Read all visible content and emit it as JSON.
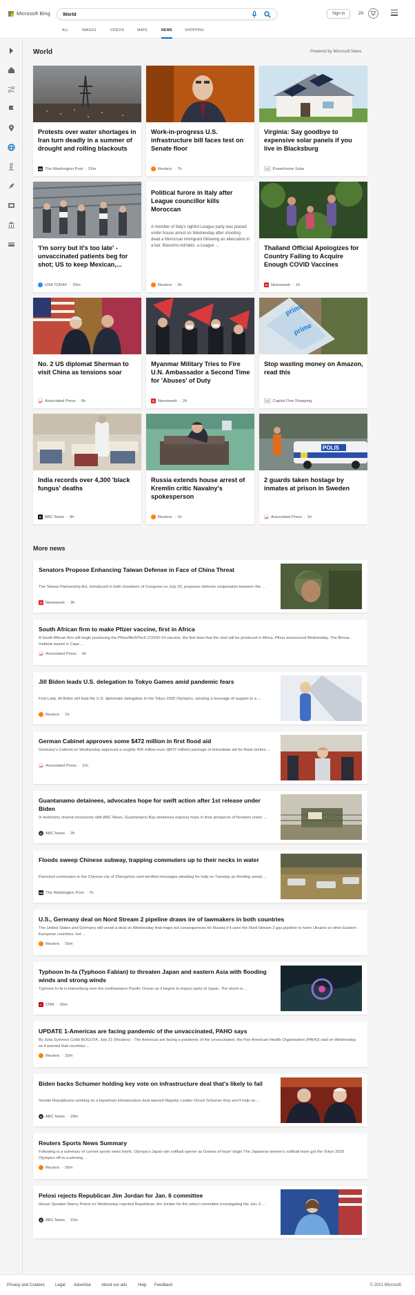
{
  "header": {
    "logo_text": "Microsoft Bing",
    "search_value": "World",
    "signin_label": "Sign in",
    "reward_points": "20"
  },
  "tabs": [
    "ALL",
    "IMAGES",
    "VIDEOS",
    "MAPS",
    "NEWS",
    "SHOPPING"
  ],
  "active_tab": "NEWS",
  "section": {
    "title": "World",
    "powered_by": "Powered by Microsoft News"
  },
  "cards": [
    {
      "title": "Protests over water shortages in Iran turn deadly in a summer of drought and rolling blackouts",
      "source": "The Washington Post",
      "time": "52m",
      "badge": "wp"
    },
    {
      "title": "Work-in-progress U.S. infrastructure bill faces test on Senate floor",
      "source": "Reuters",
      "time": "7h",
      "badge": "reuters"
    },
    {
      "title": "Virginia: Say goodbye to expensive solar panels if you live in Blacksburg",
      "source": "Powerhome Solar",
      "time": "",
      "badge": "ad"
    },
    {
      "title": "'I'm sorry but it's too late' - unvaccinated patients beg for shot; US to keep Mexican,...",
      "source": "USA TODAY",
      "time": "25m",
      "badge": "usatoday"
    },
    {
      "title": "Political furore in Italy after League councillor kills Moroccan",
      "snippet": "A member of Italy's rightist League party was placed under house arrest on Wednesday after shooting dead a Moroccan immigrant following an altercation in a bar. Massimo Adriatici, a League ...",
      "source": "Reuters",
      "time": "2h",
      "badge": "reuters"
    },
    {
      "title": "Thailand Official Apologizes for Country Failing to Acquire Enough COVID Vaccines",
      "source": "Newsweek",
      "time": "1h",
      "badge": "newsweek"
    },
    {
      "title": "No. 2 US diplomat Sherman to visit China as tensions soar",
      "source": "Associated Press",
      "time": "6h",
      "badge": "ap"
    },
    {
      "title": "Myanmar Military Tries to Fire U.N. Ambassador a Second Time for 'Abuses' of Duty",
      "source": "Newsweek",
      "time": "2h",
      "badge": "newsweek"
    },
    {
      "title": "Stop wasting money on Amazon, read this",
      "source": "Capital One Shopping",
      "time": "",
      "badge": "ad"
    },
    {
      "title": "India records over 4,300 'black fungus' deaths",
      "source": "BBC News",
      "time": "9h",
      "badge": "bbc"
    },
    {
      "title": "Russia extends house arrest of Kremlin critic Navalny's spokesperson",
      "source": "Reuters",
      "time": "1h",
      "badge": "reuters"
    },
    {
      "title": "2 guards taken hostage by inmates at prison in Sweden",
      "source": "Associated Press",
      "time": "1h",
      "badge": "ap"
    }
  ],
  "ad_label": "Ad",
  "more_news": {
    "title": "More news",
    "items": [
      {
        "title": "Senators Propose Enhancing Taiwan Defense in Face of China Threat",
        "snippet": "The Taiwan Partnership Act, introduced in both chambers of Congress on July 20, proposes defense cooperation between the ...",
        "source": "Newsweek",
        "time": "3h",
        "badge": "newsweek",
        "image": "soldier"
      },
      {
        "title": "South African firm to make Pfizer vaccine, first in Africa",
        "snippet": "A South African firm will begin producing the Pfizer/BioNTech COVID-19 vaccine, the first time that the shot will be produced in Africa, Pfizer announced Wednesday. The Biovac Institute based in Cape ...",
        "source": "Associated Press",
        "time": "5h",
        "badge": "ap",
        "image": ""
      },
      {
        "title": "Jill Biden leads U.S. delegation to Tokyo Games amid pandemic fears",
        "snippet": "First Lady Jill Biden will lead the U.S. diplomatic delegation to the Tokyo 2020 Olympics, sending a message of support to a ...",
        "source": "Reuters",
        "time": "1h",
        "badge": "reuters",
        "image": "jill"
      },
      {
        "title": "German Cabinet approves some $472 million in first flood aid",
        "snippet": "Germany's Cabinet on Wednesday approved a roughly 400 million-euro ($472 million) package of immediate aid for flood victims ...",
        "source": "Associated Press",
        "time": "11h",
        "badge": "ap",
        "image": "merkel"
      },
      {
        "title": "Guantanamo detainees, advocates hope for swift action after 1st release under Biden",
        "snippet": "In testimony shared exclusively with ABC News, Guantanamo Bay detainees express hope in their prospects of freedom under ...",
        "source": "ABC News",
        "time": "2h",
        "badge": "abc",
        "image": "gitmo"
      },
      {
        "title": "Floods sweep Chinese subway, trapping commuters up to their necks in water",
        "snippet": "Panicked commuters in the Chinese city of Zhengzhou sent terrified messages pleading for help on Tuesday as flooding swept ...",
        "source": "The Washington Post",
        "time": "7h",
        "badge": "wp",
        "image": "flood"
      },
      {
        "title": "U.S., Germany deal on Nord Stream 2 pipeline draws ire of lawmakers in both countries",
        "snippet": "The United States and Germany will unveil a deal on Wednesday that maps out consequences for Russia if it uses the Nord Stream 2 gas pipeline to harm Ukraine or other Eastern European countries, but ...",
        "source": "Reuters",
        "time": "55m",
        "badge": "reuters",
        "image": ""
      },
      {
        "title": "Typhoon In-fa (Typhoon Fabian) to threaten Japan and eastern Asia with flooding winds and strong winds",
        "snippet": "Typhoon In-fa is intensifying over the northwestern Pacific Ocean as it begins to impact parts of Japan. The storm is ...",
        "source": "CNN",
        "time": "26m",
        "badge": "cnn",
        "image": "typhoon"
      },
      {
        "title": "UPDATE 1-Americas are facing pandemic of the unvaccinated, PAHO says",
        "snippet": "By Julia Symmes Cobb BOGOTA, July 21 (Reuters) - The Americas are facing a pandemic of the unvaccinated, the Pan American Health Organization (PAHO) said on Wednesday, as it warned that countries ...",
        "source": "Reuters",
        "time": "33m",
        "badge": "reuters",
        "image": ""
      },
      {
        "title": "Biden backs Schumer holding key vote on infrastructure deal that's likely to fail",
        "snippet": "Senate Republicans working on a bipartisan infrastructure deal warned Majority Leader Chuck Schumer they won't help on ...",
        "source": "ABC News",
        "time": "29m",
        "badge": "abc",
        "image": "biden"
      },
      {
        "title": "Reuters Sports News Summary",
        "snippet": "Following is a summary of current sports news briefs. Olympics-Japan win softball opener as Games of hope' begin The Japanese women's softball team got the Tokyo 2020 Olympics off to a winning ...",
        "source": "Reuters",
        "time": "56m",
        "badge": "reuters",
        "image": ""
      },
      {
        "title": "Pelosi rejects Republican Jim Jordan for Jan. 6 committee",
        "snippet": "House Speaker Nancy Pelosi on Wednesday rejected Republican Jim Jordan for the select committee investigating the Jan. 6 ...",
        "source": "ABC News",
        "time": "22m",
        "badge": "abc",
        "image": "pelosi"
      }
    ]
  },
  "footer": {
    "links": [
      "Privacy and Cookies",
      "Legal",
      "Advertise",
      "About our ads",
      "Help",
      "Feedback"
    ],
    "copyright": "© 2021 Microsoft"
  },
  "colors": {
    "accent": "#0072c6",
    "brand_red": "#f25022",
    "brand_green": "#7fba00",
    "brand_blue": "#00a4ef",
    "brand_yellow": "#ffb900"
  }
}
